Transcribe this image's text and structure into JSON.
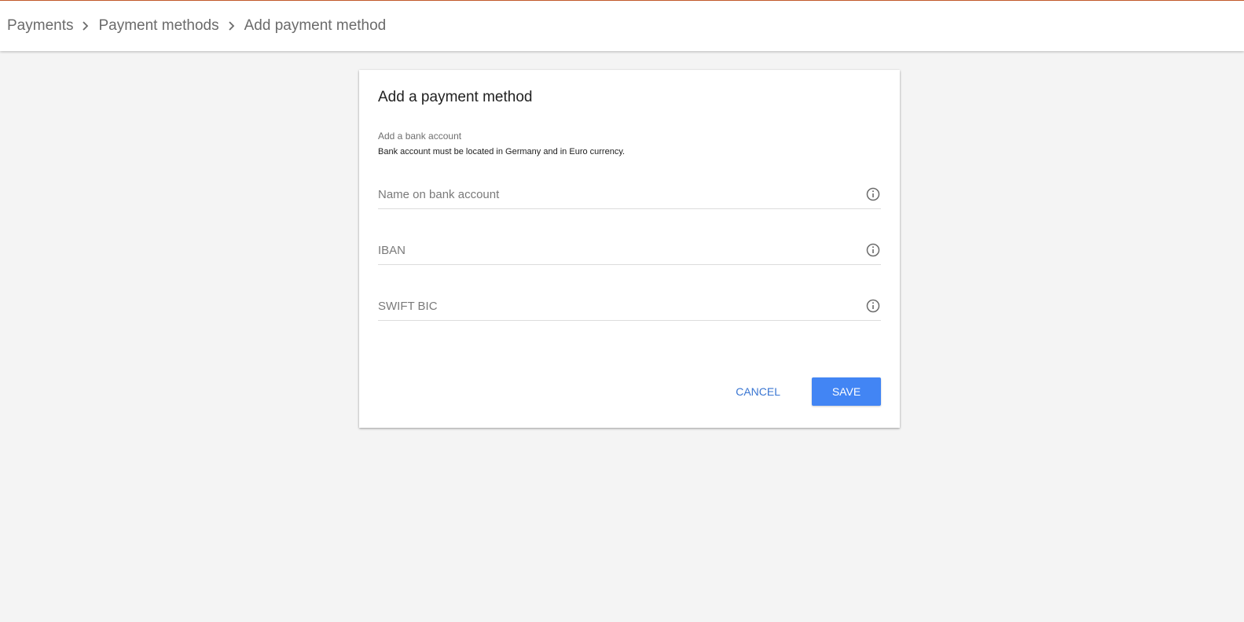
{
  "breadcrumb": {
    "items": [
      "Payments",
      "Payment methods",
      "Add payment method"
    ]
  },
  "card": {
    "title": "Add a payment method",
    "section_label": "Add a bank account",
    "section_desc": "Bank account must be located in Germany and in Euro currency.",
    "fields": [
      {
        "placeholder": "Name on bank account",
        "value": "",
        "icon": "info-icon"
      },
      {
        "placeholder": "IBAN",
        "value": "",
        "icon": "info-icon"
      },
      {
        "placeholder": "SWIFT BIC",
        "value": "",
        "icon": "info-icon"
      }
    ],
    "cancel_label": "CANCEL",
    "save_label": "SAVE"
  },
  "colors": {
    "accent": "#4285f4",
    "link": "#3a76d2",
    "top_border": "#c1592b",
    "background": "#f4f4f4"
  }
}
